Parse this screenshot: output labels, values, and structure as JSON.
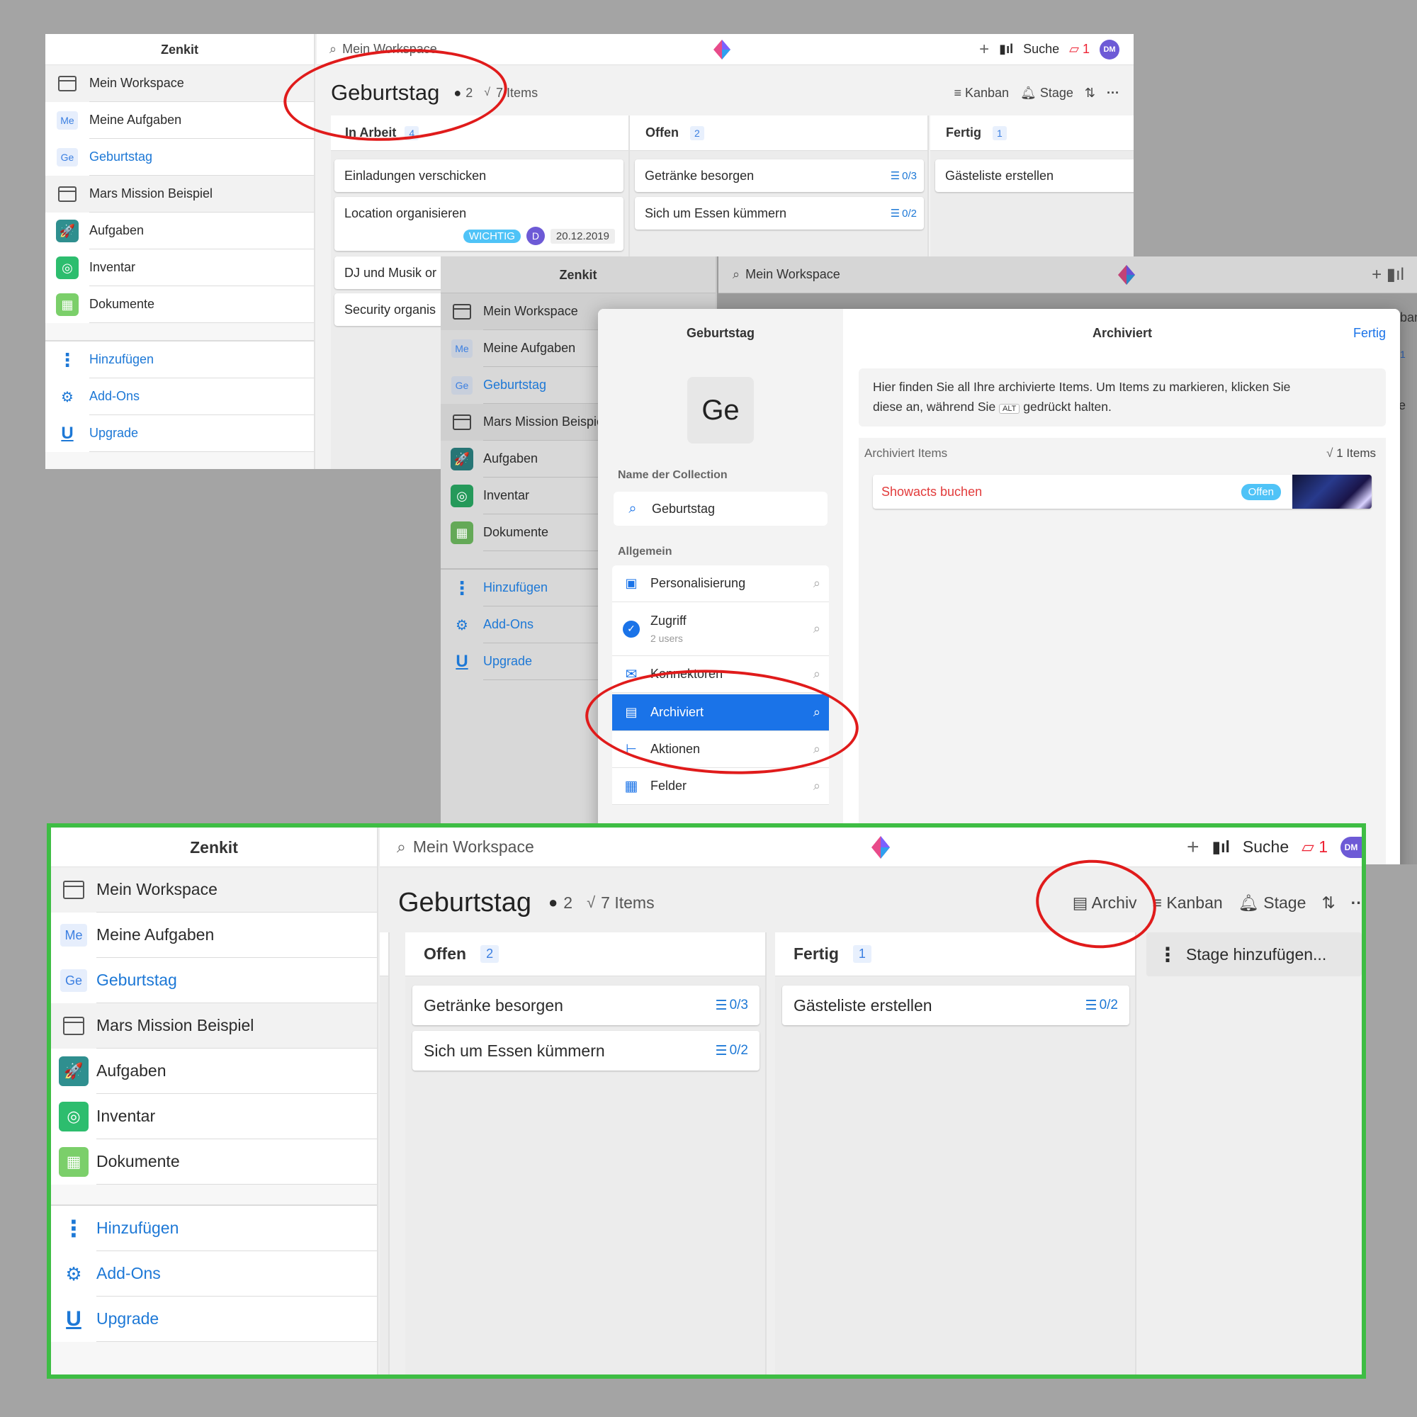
{
  "app": {
    "name": "Zenkit",
    "workspace": "Mein Workspace",
    "search_label": "Suche",
    "notification_count": "1",
    "avatar_initials": "DM"
  },
  "sidebar": {
    "items": [
      {
        "label": "Mein Workspace",
        "icon": "workspace-icon"
      },
      {
        "label": "Meine Aufgaben",
        "badge": "Me"
      },
      {
        "label": "Geburtstag",
        "badge": "Ge"
      },
      {
        "label": "Mars Mission Beispiel",
        "icon": "workspace-icon"
      },
      {
        "label": "Aufgaben",
        "icon": "rocket-icon"
      },
      {
        "label": "Inventar",
        "icon": "inventory-icon"
      },
      {
        "label": "Dokumente",
        "icon": "map-icon"
      }
    ],
    "actions": [
      {
        "label": "Hinzufügen",
        "icon": "more-vertical-icon"
      },
      {
        "label": "Add-Ons",
        "icon": "gears-icon"
      },
      {
        "label": "Upgrade",
        "icon": "upgrade-icon"
      }
    ]
  },
  "board": {
    "title": "Geburtstag",
    "done_count": "2",
    "items_label": "7 Items",
    "view_kanban": "Kanban",
    "view_stage": "Stage",
    "archive_label": "Archiv",
    "add_stage": "Stage hinzufügen...",
    "columns": [
      {
        "name": "In Arbeit",
        "count": "4",
        "cards": [
          {
            "title": "Einladungen verschicken"
          },
          {
            "title": "Location organisieren",
            "tag": "WICHTIG",
            "assignee": "D",
            "date": "20.12.2019"
          },
          {
            "title": "DJ und Musik or"
          },
          {
            "title": "Security organis"
          }
        ]
      },
      {
        "name": "Offen",
        "count": "2",
        "cards": [
          {
            "title": "Getränke besorgen",
            "checklist": "0/3"
          },
          {
            "title": "Sich um Essen kümmern",
            "checklist": "0/2"
          }
        ]
      },
      {
        "name": "Fertig",
        "count": "1",
        "cards": [
          {
            "title": "Gästeliste erstellen",
            "checklist": "0/2"
          }
        ]
      }
    ]
  },
  "modal": {
    "collection_title": "Geburtstag",
    "collection_badge": "Ge",
    "name_label": "Name der Collection",
    "name_value": "Geburtstag",
    "section_general": "Allgemein",
    "settings": [
      {
        "label": "Personalisierung",
        "icon": "personalize-icon"
      },
      {
        "label": "Zugriff",
        "sub": "2 users",
        "icon": "check-circle-icon"
      },
      {
        "label": "Konnektoren",
        "icon": "mail-icon"
      },
      {
        "label": "Archiviert",
        "icon": "archive-icon",
        "active": true
      },
      {
        "label": "Aktionen",
        "icon": "actions-icon"
      },
      {
        "label": "Felder",
        "icon": "table-icon"
      }
    ],
    "panel_title": "Archiviert",
    "done_button": "Fertig",
    "info_text_1": "Hier finden Sie all Ihre archivierte Items. Um Items zu markieren, klicken Sie",
    "info_text_2a": "diese an, während Sie",
    "info_key": "ALT",
    "info_text_2b": "gedrückt halten.",
    "archived_section": "Archiviert Items",
    "archived_count": "1 Items",
    "archived_item": "Showacts buchen",
    "archived_status": "Offen",
    "partial_kanban": "nban",
    "partial_count": "1",
    "partial_liste": "liste"
  },
  "colors": {
    "accent": "#1a73e8",
    "annotation": "#e01b1b",
    "frame": "#3ebd44",
    "background": "#a4a4a4"
  }
}
